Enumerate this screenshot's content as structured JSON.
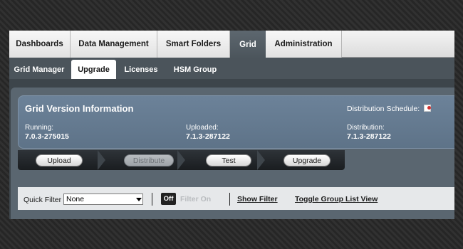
{
  "top_tabs": [
    {
      "label": "Dashboards",
      "active": false
    },
    {
      "label": "Data Management",
      "active": false
    },
    {
      "label": "Smart Folders",
      "active": false
    },
    {
      "label": "Grid",
      "active": true
    },
    {
      "label": "Administration",
      "active": false
    }
  ],
  "sub_tabs": [
    {
      "label": "Grid Manager",
      "active": false
    },
    {
      "label": "Upgrade",
      "active": true
    },
    {
      "label": "Licenses",
      "active": false
    },
    {
      "label": "HSM Group",
      "active": false
    }
  ],
  "version_info": {
    "title": "Grid Version Information",
    "schedule_label": "Distribution Schedule:",
    "running_label": "Running:",
    "running_value": "7.0.3-275015",
    "uploaded_label": "Uploaded:",
    "uploaded_value": "7.1.3-287122",
    "distribution_label": "Distribution:",
    "distribution_value": "7.1.3-287122"
  },
  "workflow": [
    {
      "label": "Upload",
      "enabled": true
    },
    {
      "label": "Distribute",
      "enabled": false
    },
    {
      "label": "Test",
      "enabled": true
    },
    {
      "label": "Upgrade",
      "enabled": true
    }
  ],
  "filter": {
    "quick_filter_label": "Quick Filter",
    "quick_filter_value": "None",
    "off_label": "Off",
    "filter_on_label": "Filter On",
    "show_filter_link": "Show Filter",
    "toggle_group_link": "Toggle Group List View"
  },
  "colors": {
    "active_tab_bg": "#535d65",
    "info_box_bg": "#6a7f96",
    "filter_bar_bg": "#e6e8ea"
  },
  "icons": {
    "schedule": "calendar-icon",
    "dropdown": "chevron-down-icon"
  }
}
